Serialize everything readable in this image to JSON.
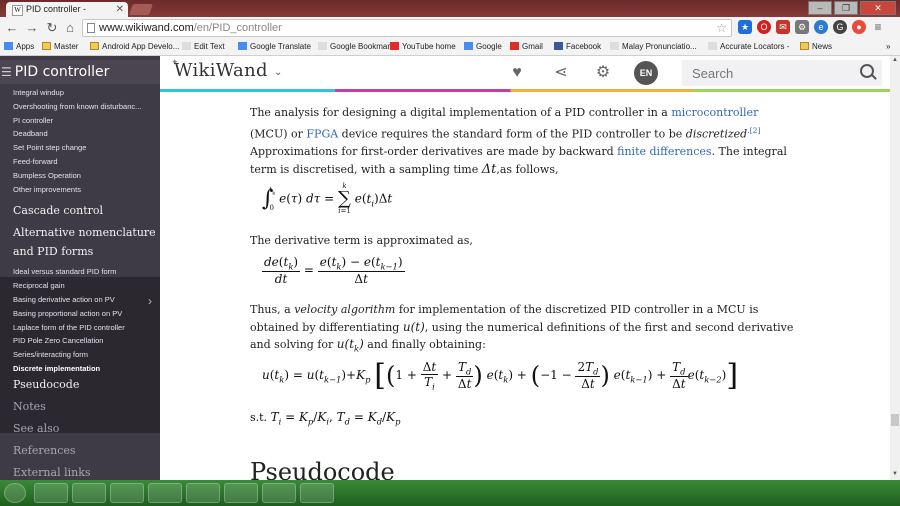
{
  "browser": {
    "tab_title": "PID controller - WikiWand",
    "tab_close": "✕",
    "favicon": "W",
    "url_host": "www.wikiwand.com",
    "url_path": "/en/PID_controller",
    "bookmarks": [
      {
        "label": "Apps",
        "icon": "apps-grid-icon"
      },
      {
        "label": "Master",
        "icon": "folder-icon"
      },
      {
        "label": "Android App Develo...",
        "icon": "folder-icon"
      },
      {
        "label": "Edit Text",
        "icon": "page-icon"
      },
      {
        "label": "Google Translate",
        "icon": "translate-icon"
      },
      {
        "label": "Google Bookmark",
        "icon": "page-icon"
      },
      {
        "label": "YouTube home",
        "icon": "youtube-icon"
      },
      {
        "label": "Google",
        "icon": "google-icon"
      },
      {
        "label": "Gmail",
        "icon": "gmail-icon"
      },
      {
        "label": "Facebook",
        "icon": "facebook-icon"
      },
      {
        "label": "Malay Pronunciatio...",
        "icon": "page-icon"
      },
      {
        "label": "Accurate Locators -",
        "icon": "page-icon"
      },
      {
        "label": "News",
        "icon": "folder-icon"
      }
    ],
    "more_bookmarks": "»"
  },
  "sidebar": {
    "title": "PID controller",
    "items": [
      {
        "label": "Integral windup",
        "type": "sub"
      },
      {
        "label": "Overshooting from known disturbanc...",
        "type": "sub"
      },
      {
        "label": "PI controller",
        "type": "sub"
      },
      {
        "label": "Deadband",
        "type": "sub"
      },
      {
        "label": "Set Point step change",
        "type": "sub"
      },
      {
        "label": "Feed-forward",
        "type": "sub"
      },
      {
        "label": "Bumpless Operation",
        "type": "sub"
      },
      {
        "label": "Other improvements",
        "type": "sub"
      },
      {
        "label": "Cascade control",
        "type": "section"
      },
      {
        "label": "Alternative nomenclature",
        "type": "section"
      },
      {
        "label": "and PID forms",
        "type": "section"
      },
      {
        "label": "Ideal versus standard PID form",
        "type": "sub"
      },
      {
        "label": "Reciprocal gain",
        "type": "sub"
      },
      {
        "label": "Basing derivative action on PV",
        "type": "sub"
      },
      {
        "label": "Basing proportional action on PV",
        "type": "sub"
      },
      {
        "label": "Laplace form of the PID controller",
        "type": "sub"
      },
      {
        "label": "PID Pole Zero Cancellation",
        "type": "sub"
      },
      {
        "label": "Series/interacting form",
        "type": "sub"
      },
      {
        "label": "Discrete implementation",
        "type": "sub-current"
      },
      {
        "label": "Pseudocode",
        "type": "section"
      },
      {
        "label": "Notes",
        "type": "section-muted"
      },
      {
        "label": "See also",
        "type": "section-muted"
      },
      {
        "label": "References",
        "type": "section-muted"
      },
      {
        "label": "External links",
        "type": "section-muted"
      }
    ]
  },
  "header": {
    "logo": "WikiWand",
    "lang": "EN",
    "search_placeholder": "Search",
    "icons": [
      "heart-icon",
      "share-icon",
      "gear-icon"
    ]
  },
  "content": {
    "p1": {
      "t1": "The analysis for designing a digital implementation of a PID controller in a ",
      "link1": "microcontroller",
      "t2": " (MCU) or ",
      "link2": "FPGA",
      "t3": " device requires the standard form of the PID controller to be ",
      "em1": "discretized",
      "ref": ".[2]",
      "t4": " Approximations for first-order derivatives are made by backward ",
      "link3": "finite differences",
      "t5": ". The integral term is discretised, with a sampling time ",
      "dt": "Δt",
      "t6": ",as follows,"
    },
    "p2": "The derivative term is approximated as,",
    "p3": {
      "t1": "Thus, a ",
      "em1": "velocity algorithm",
      "t2": " for implementation of the discretized PID controller in a MCU is obtained by differentiating ",
      "m1": "u(t)",
      "t3": ", using the numerical definitions of the first and second derivative and solving for ",
      "m2": "u(t",
      "m2sub": "k",
      "m2end": ")",
      "t4": " and finally obtaining:"
    },
    "p4": {
      "st": "s.t. ",
      "formula": "T",
      "rest": ""
    },
    "pseudocode_heading": "Pseudocode"
  },
  "colors": {
    "link": "#3366bb",
    "sidebar_bg": "#3f3b45",
    "sidebar_active_bg": "#2b2830",
    "rainbow": [
      "#2ec6d6",
      "#c23fa8",
      "#f0b23a",
      "#9bd45a"
    ]
  }
}
